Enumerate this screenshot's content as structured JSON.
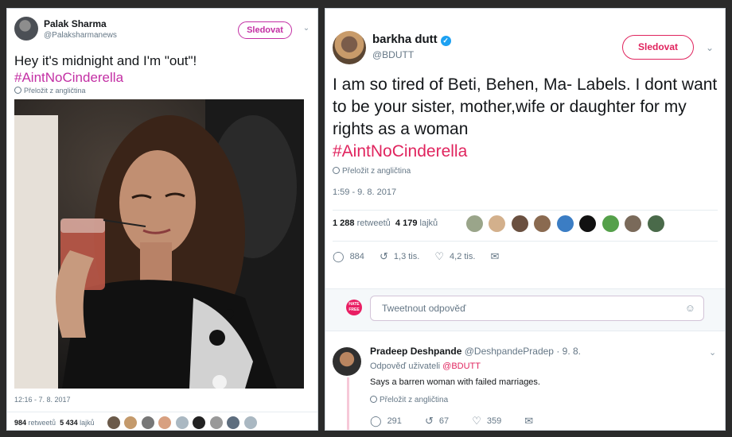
{
  "left_tweet": {
    "author_name": "Palak Sharma",
    "author_handle": "@Palaksharmanews",
    "follow_label": "Sledovat",
    "text_line": "Hey it's midnight and I'm \"out\"!",
    "hashtag": "#AintNoCinderella",
    "translate_label": "Přeložit z angličtina",
    "timestamp": "12:16 - 7. 8. 2017",
    "retweets_count": "984",
    "retweets_label": "retweetů",
    "likes_count": "5 434",
    "likes_label": "lajků"
  },
  "right_tweet": {
    "author_name": "barkha dutt",
    "author_handle": "@BDUTT",
    "follow_label": "Sledovat",
    "text": "I am so tired of Beti, Behen, Ma- Labels. I dont want to be your sister, mother,wife or daughter for my rights as a woman",
    "hashtag": "#AintNoCinderella",
    "translate_label": "Přeložit z angličtina",
    "timestamp": "1:59 - 9. 8. 2017",
    "retweets_count": "1 288",
    "retweets_label": "retweetů",
    "likes_count": "4 179",
    "likes_label": "lajků",
    "reply_count": "884",
    "retweet_action_count": "1,3 tis.",
    "like_action_count": "4,2 tis.",
    "reply_placeholder": "Tweetnout odpověď",
    "hate_logo_text": "HATE FREE"
  },
  "reply_tweet": {
    "author_name": "Pradeep Deshpande",
    "author_handle": "@DeshpandePradep",
    "date": "· 9. 8.",
    "reply_to_label": "Odpověď uživateli",
    "reply_to_handle": "@BDUTT",
    "text": "Says a barren woman with failed marriages.",
    "translate_label": "Přeložit z angličtina",
    "reply_count": "291",
    "retweet_count": "67",
    "like_count": "359"
  },
  "colors": {
    "left_accent": "#c32fa4",
    "right_accent": "#e0245e",
    "muted": "#657786",
    "frame": "#2a2a2a"
  },
  "icons": [
    "chevron-down-icon",
    "verified-icon",
    "globe-icon",
    "reply-icon",
    "retweet-icon",
    "like-icon",
    "dm-icon",
    "emoji-icon"
  ]
}
